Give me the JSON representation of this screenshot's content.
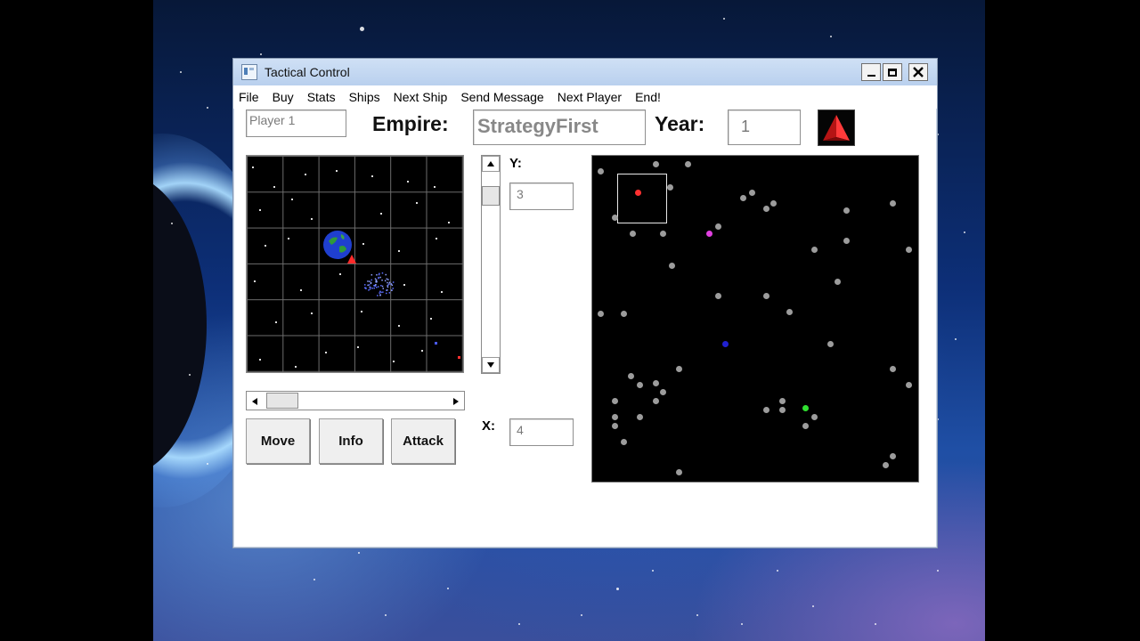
{
  "window": {
    "title": "Tactical Control",
    "controls": [
      "minimize",
      "maximize",
      "close"
    ]
  },
  "menu": [
    "File",
    "Buy",
    "Stats",
    "Ships",
    "Next Ship",
    "Send Message",
    "Next Player",
    "End!"
  ],
  "header": {
    "player": "Player  1",
    "empire_label": "Empire:",
    "empire_value": "StrategyFirst",
    "year_label": "Year:",
    "year_value": "1"
  },
  "coords": {
    "y_label": "Y:",
    "y_value": "3",
    "x_label": "X:",
    "x_value": "4"
  },
  "buttons": {
    "move": "Move",
    "info": "Info",
    "attack": "Attack"
  },
  "colors": {
    "empire_emblem": "#d42020",
    "player_ship": "#ff3030",
    "magenta_empire": "#e040e0",
    "blue_empire": "#2020d0",
    "green_empire": "#30e030",
    "neutral_system": "#9c9c9c"
  },
  "icons": {
    "emblem": "red-pyramid-icon",
    "planet": "earth-planet-icon",
    "nebula": "nebula-icon",
    "ship": "red-ship-icon"
  }
}
